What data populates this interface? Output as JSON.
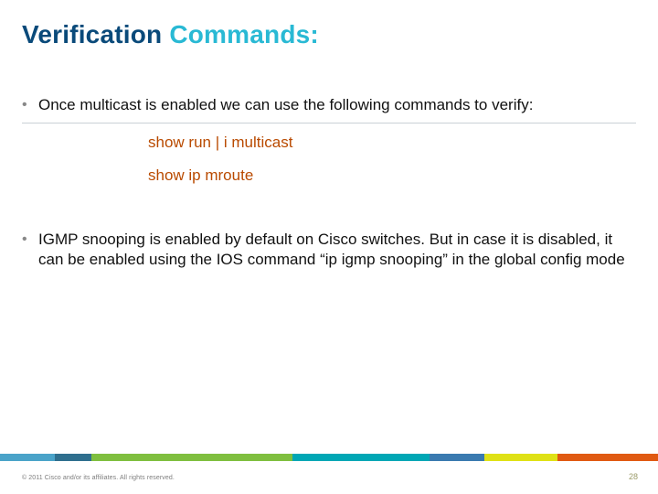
{
  "title": {
    "word1": "Verification",
    "word2": "Commands:"
  },
  "bullets": {
    "b1": "Once multicast is enabled we can use the following commands to verify:",
    "b2": "IGMP snooping is enabled by default on Cisco switches. But in case it is disabled, it can be enabled using the IOS command “ip igmp snooping” in the global config mode"
  },
  "commands": {
    "c1": "show run | i multicast",
    "c2": "show ip mroute"
  },
  "footer": {
    "copyright": "© 2011 Cisco and/or its affiliates. All rights reserved.",
    "page": "28"
  }
}
